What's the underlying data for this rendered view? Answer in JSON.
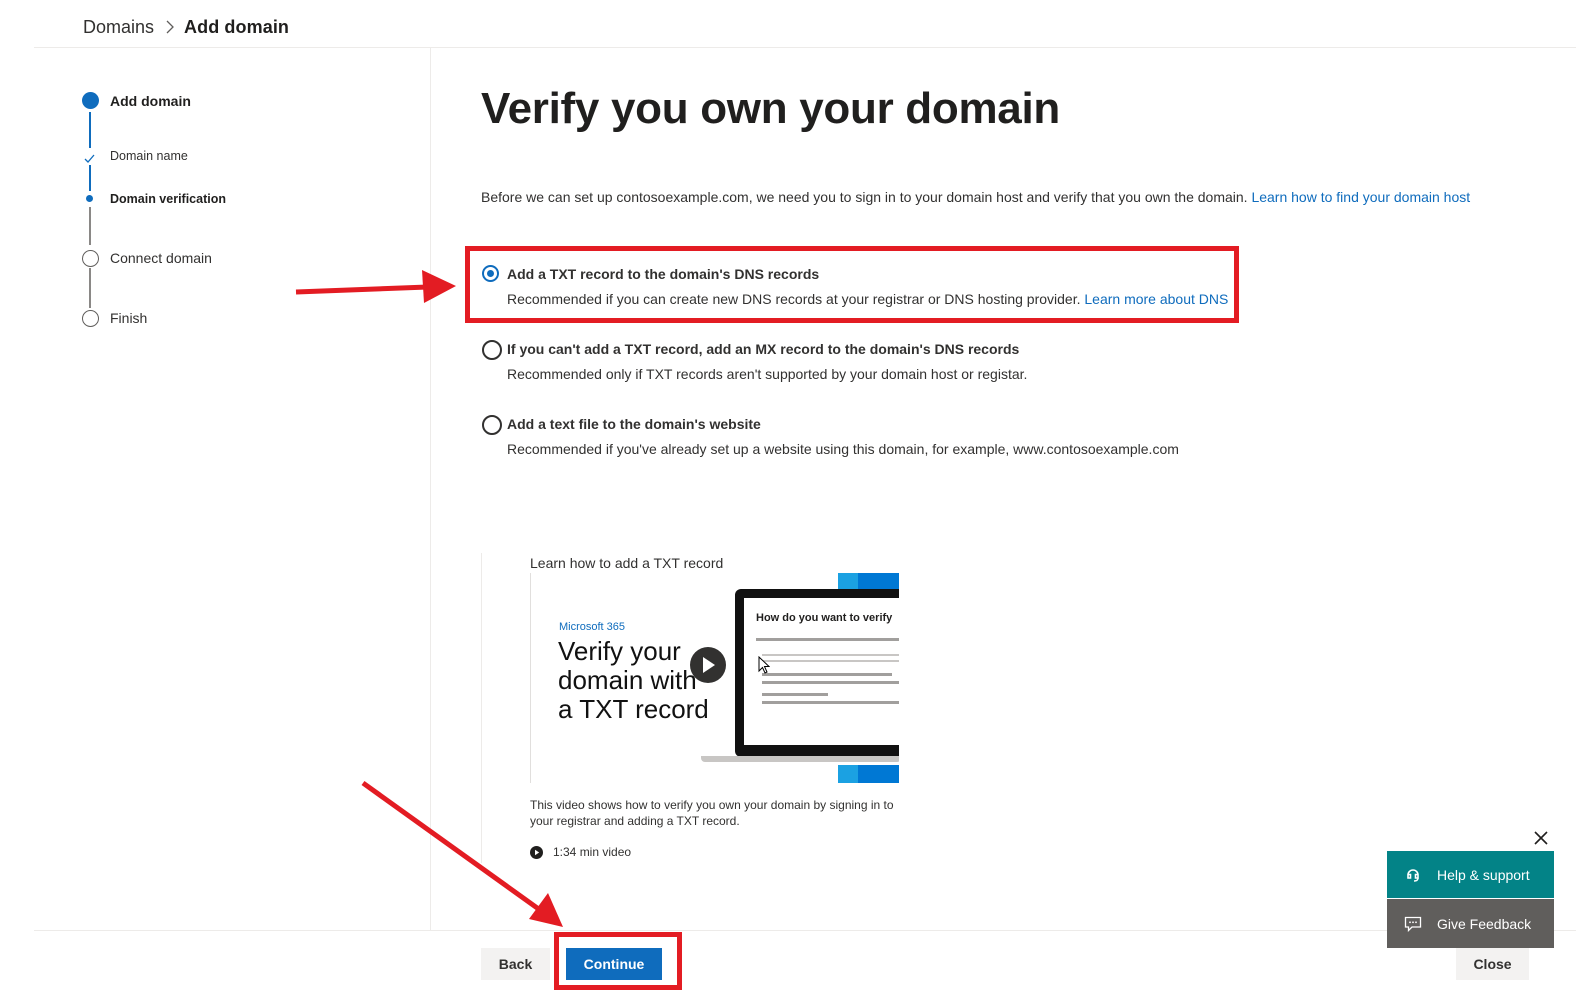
{
  "breadcrumb": {
    "parent": "Domains",
    "current": "Add domain"
  },
  "steps": {
    "add_domain": "Add domain",
    "domain_name": "Domain name",
    "domain_verification": "Domain verification",
    "connect_domain": "Connect domain",
    "finish": "Finish"
  },
  "main": {
    "title": "Verify you own your domain",
    "intro": "Before we can set up contosoexample.com, we need you to sign in to your domain host and verify that you own the domain.",
    "intro_link": "Learn how to find your domain host"
  },
  "options": [
    {
      "title": "Add a TXT record to the domain's DNS records",
      "desc": "Recommended if you can create new DNS records at your registrar or DNS hosting provider.",
      "link": "Learn more about DNS",
      "selected": true
    },
    {
      "title": "If you can't add a TXT record, add an MX record to the domain's DNS records",
      "desc": "Recommended only if TXT records aren't supported by your domain host or registar.",
      "selected": false
    },
    {
      "title": "Add a text file to the domain's website",
      "desc": "Recommended if you've already set up a website using this domain, for example, www.contosoexample.com",
      "selected": false
    }
  ],
  "video": {
    "heading": "Learn how to add a TXT record",
    "brand": "Microsoft 365",
    "thumb_title_1": "Verify your",
    "thumb_title_2": "domain with",
    "thumb_title_3": "a TXT record",
    "screen_heading": "How do you want to verify",
    "description": "This video shows how to verify you own your domain by signing in to your registrar and adding a TXT record.",
    "length": "1:34 min video"
  },
  "buttons": {
    "back": "Back",
    "continue": "Continue",
    "close": "Close"
  },
  "help_panel": {
    "help_support": "Help & support",
    "give_feedback": "Give Feedback"
  },
  "colors": {
    "accent": "#0f6cbd",
    "annotation_red": "#e31c23",
    "help_teal": "#038387",
    "feedback_gray": "#605e5c"
  }
}
